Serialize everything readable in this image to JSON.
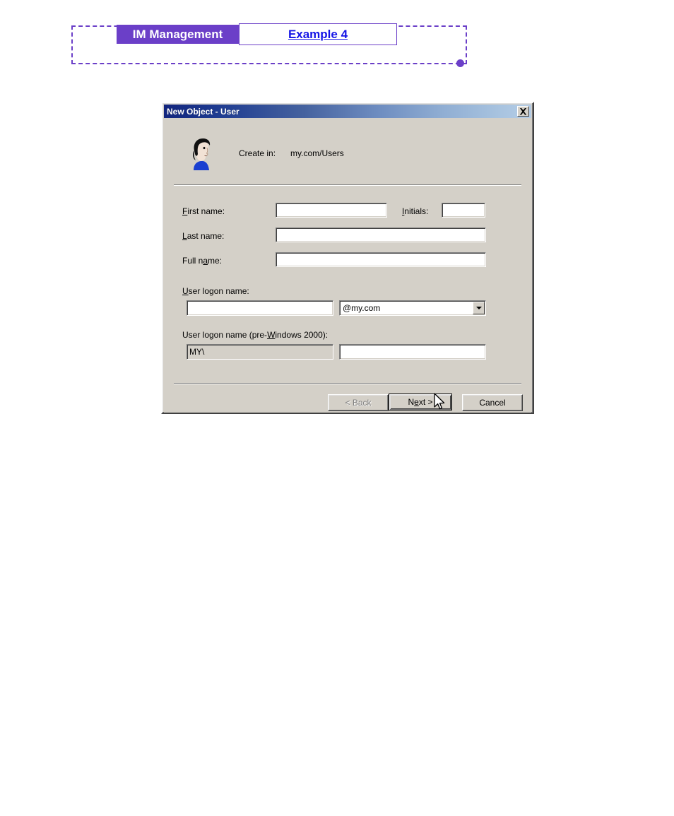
{
  "header": {
    "tab_primary_label": "IM Management",
    "tab_secondary_label": "Example 4",
    "accent_purple": "#6b3fc8",
    "link_blue": "#1414e6"
  },
  "dialog": {
    "title": "New Object - User",
    "close_icon": "close-x-icon",
    "user_icon": "user-head-icon",
    "create_in": {
      "label": "Create in:",
      "value": "my.com/Users"
    },
    "fields": {
      "first_name": {
        "label_pre": "",
        "label_accel": "F",
        "label_post": "irst name:",
        "value": ""
      },
      "initials": {
        "label_pre": "",
        "label_accel": "I",
        "label_post": "nitials:",
        "value": ""
      },
      "last_name": {
        "label_pre": "",
        "label_accel": "L",
        "label_post": "ast name:",
        "value": ""
      },
      "full_name": {
        "label_pre": "Full n",
        "label_accel": "a",
        "label_post": "me:",
        "value": ""
      },
      "user_logon_name": {
        "label_pre": "",
        "label_accel": "U",
        "label_post": "ser logon name:",
        "value": ""
      },
      "upn_suffix": {
        "selected": "@my.com",
        "arrow_icon": "chevron-down-icon"
      },
      "pre_windows_logon": {
        "label_pre": "User logon name (pre-",
        "label_accel": "W",
        "label_post": "indows 2000):",
        "domain_value": "MY\\",
        "name_value": ""
      }
    },
    "buttons": {
      "back": "< Back",
      "next_pre": "N",
      "next_accel": "e",
      "next_post": "xt >",
      "cancel": "Cancel"
    },
    "colors": {
      "face": "#d4d0c8",
      "titlebar_start": "#12257e",
      "titlebar_end": "#b4cce6"
    }
  },
  "cursor": {
    "icon": "mouse-pointer-icon"
  }
}
